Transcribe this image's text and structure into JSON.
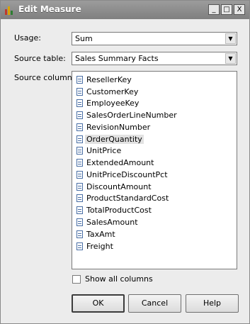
{
  "window": {
    "title": "Edit Measure"
  },
  "title_buttons": {
    "minimize": "_",
    "maximize": "□",
    "close": "X"
  },
  "usage": {
    "label": "Usage:",
    "value": "Sum"
  },
  "source_table": {
    "label": "Source table:",
    "value": "Sales Summary Facts"
  },
  "source_column": {
    "label": "Source column:",
    "selected": "OrderQuantity",
    "items": [
      "ResellerKey",
      "CustomerKey",
      "EmployeeKey",
      "SalesOrderLineNumber",
      "RevisionNumber",
      "OrderQuantity",
      "UnitPrice",
      "ExtendedAmount",
      "UnitPriceDiscountPct",
      "DiscountAmount",
      "ProductStandardCost",
      "TotalProductCost",
      "SalesAmount",
      "TaxAmt",
      "Freight"
    ]
  },
  "show_all_columns": {
    "label": "Show all columns",
    "checked": false
  },
  "buttons": {
    "ok": "OK",
    "cancel": "Cancel",
    "help": "Help"
  },
  "icons": {
    "app": "bar-chart-icon",
    "column": "table-column-icon",
    "dropdown": "chevron-down-icon"
  },
  "colors": {
    "titlebar": "#8c8c8c",
    "selection": "#e2e2e2",
    "app_icon": [
      "#c0392b",
      "#d9a300",
      "#2f7d32"
    ]
  }
}
